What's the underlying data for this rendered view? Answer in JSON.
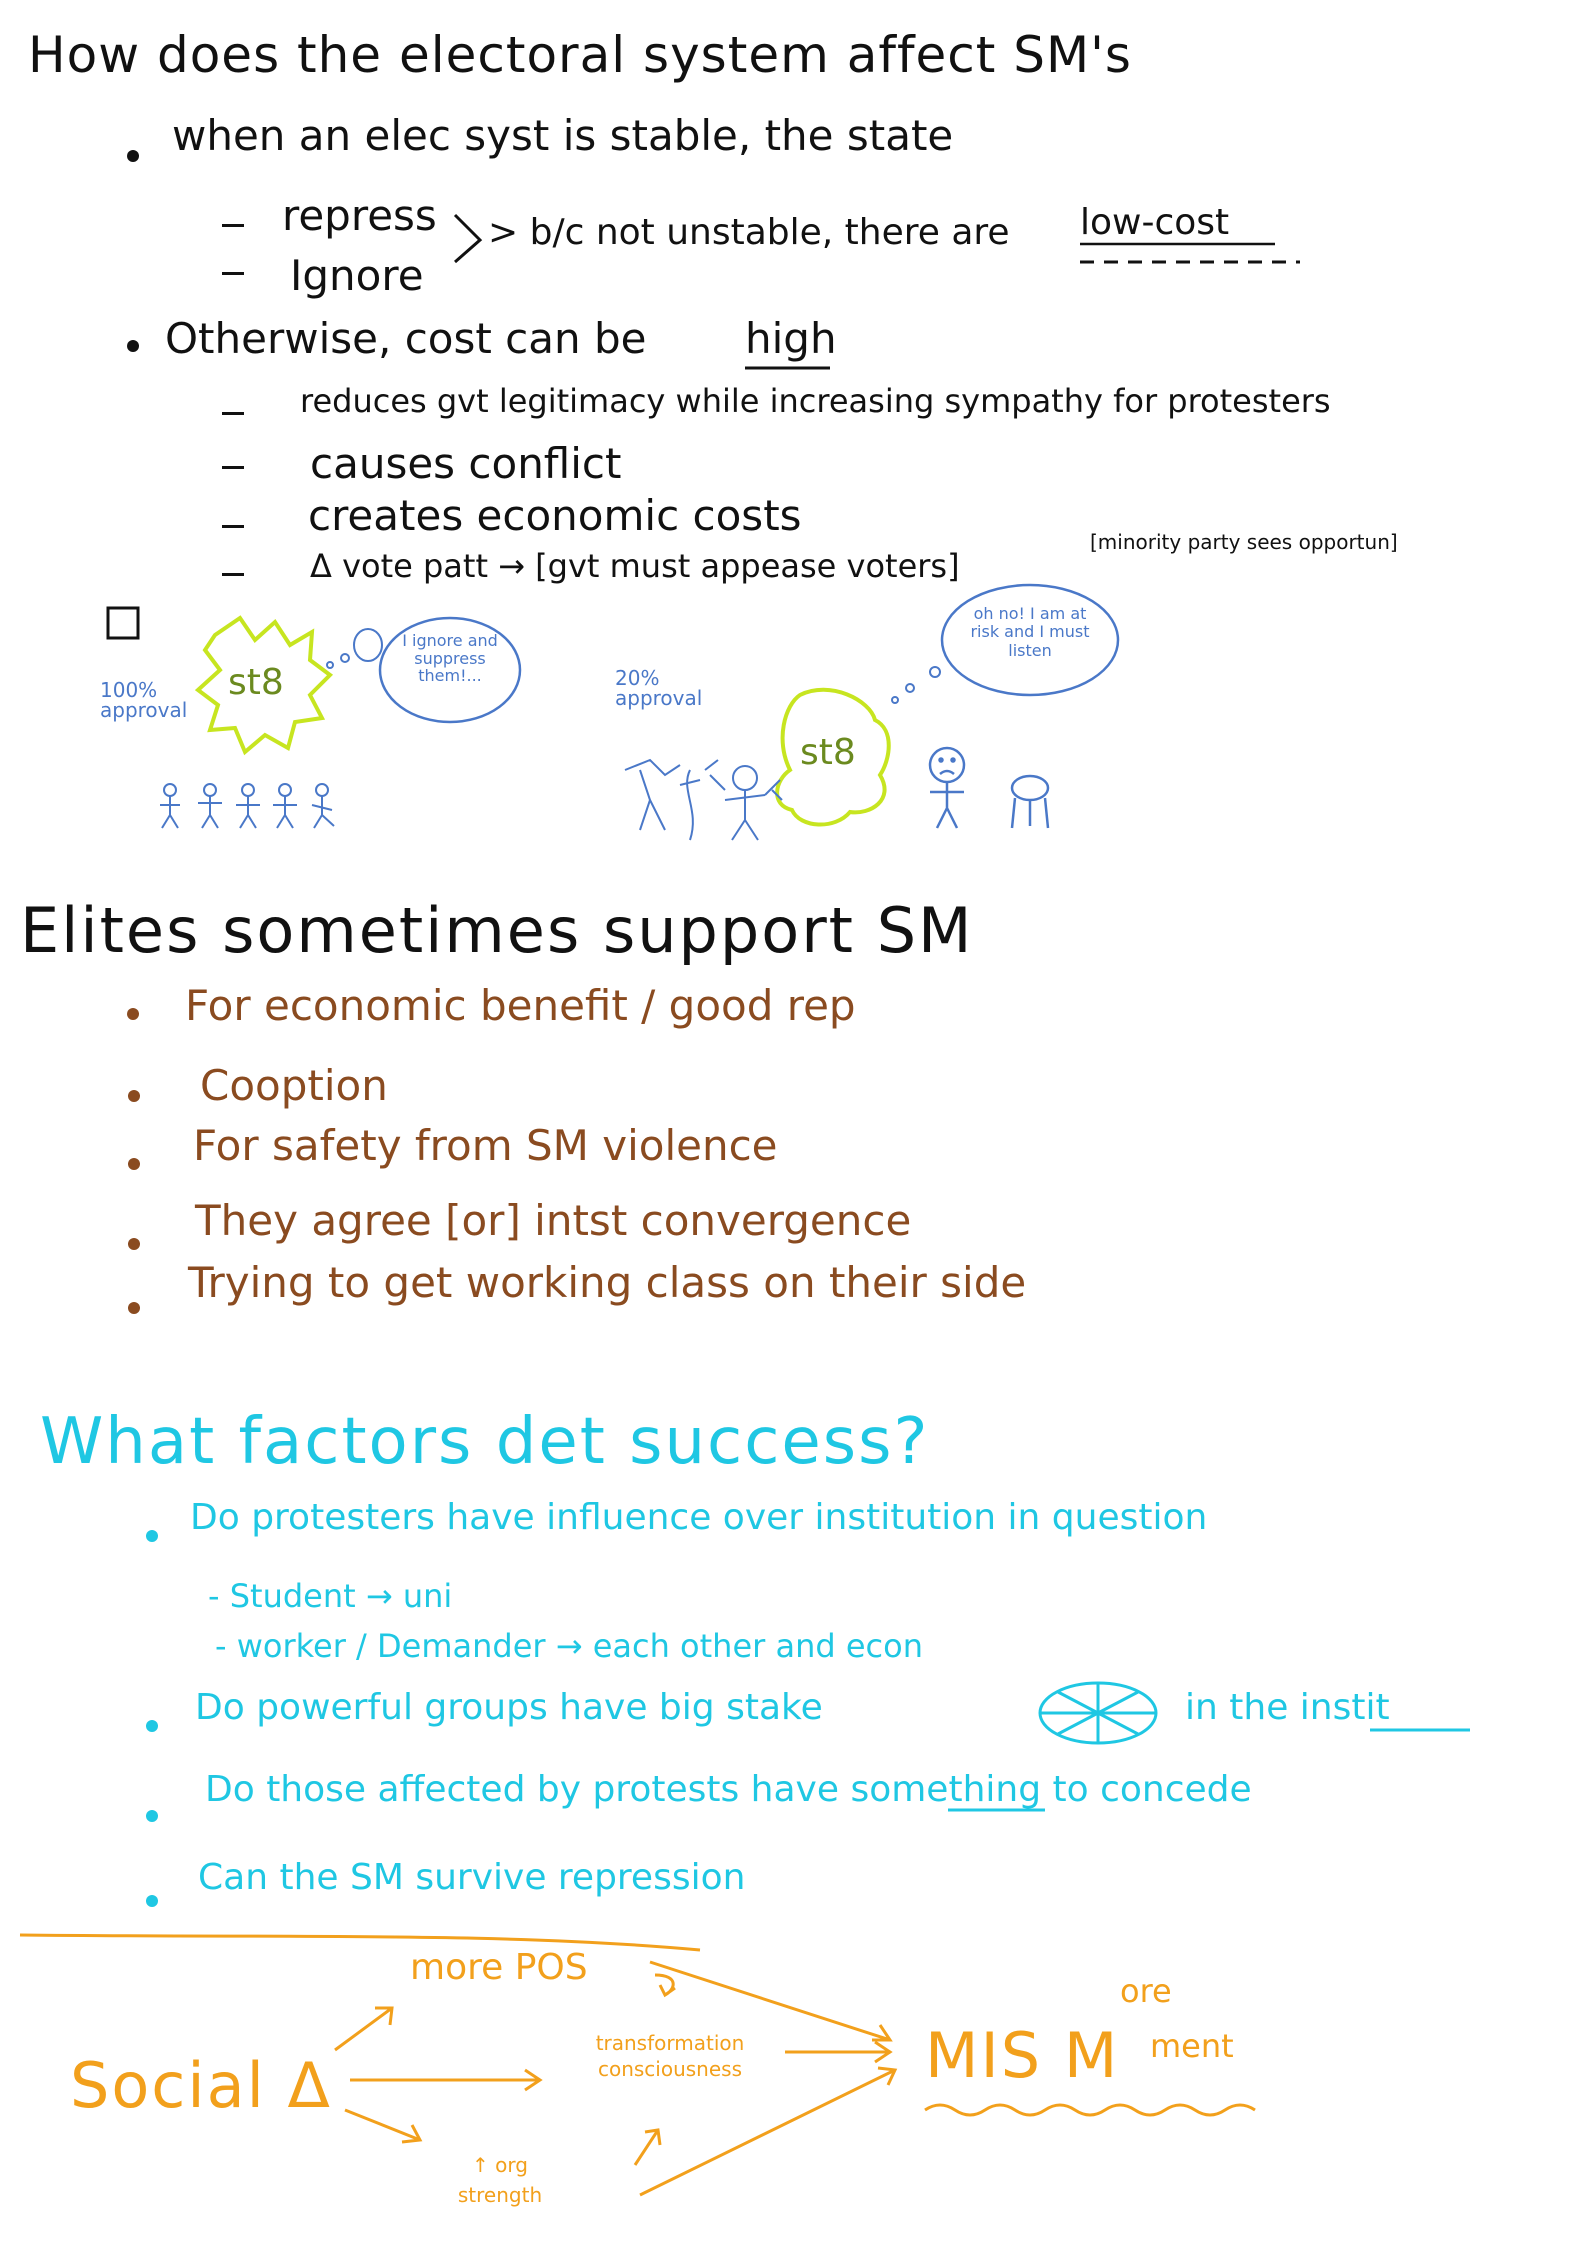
{
  "colors": {
    "ink": "#111111",
    "brown": "#8a4b20",
    "cyan": "#1fc7e3",
    "orange": "#f2a01c",
    "blue": "#4a78c8",
    "lime": "#c7e520"
  },
  "section1": {
    "heading": "How does the electoral system affect SM's",
    "b1": "when an elec syst is stable, the state",
    "sub1": "repress",
    "sub2": "Ignore",
    "brace_note": "> b/c not unstable, there are",
    "low_cost": "low-cost",
    "b2": "Otherwise, cost can be",
    "high": "high",
    "d1": "reduces gvt legitimacy while increasing sympathy for protesters",
    "d2": "causes conflict",
    "d3": "creates economic costs",
    "d4": "Δ vote patt → [gvt must appease voters]",
    "d4b": "[minority party sees opportun]"
  },
  "drawing1": {
    "approval_left": "100% approval",
    "st8": "st8",
    "bubble_left": "I ignore and suppress them!...",
    "approval_right": "20% approval",
    "bubble_right": "oh no! I am at risk and I must listen"
  },
  "section2": {
    "heading": "Elites sometimes support SM",
    "items": [
      "For economic benefit / good rep",
      "Cooption",
      "For safety from SM violence",
      "They agree [or] intst convergence",
      "Trying to get working class on their side"
    ]
  },
  "section3": {
    "heading": "What factors det success?",
    "i1": "Do protesters have influence over institution in question",
    "i1a": "- Student → uni",
    "i1b": "- worker / Demander → each other and econ",
    "i2a": "Do powerful groups have big stake",
    "i2b": "in the instit",
    "i3": "Do those affected by protests have something to concede",
    "i4": "Can the SM survive repression"
  },
  "diagram": {
    "social": "Social Δ",
    "more_pos": "more POS",
    "transformation": "transformation consciousness",
    "org_strength": "↑ org strength",
    "mis": "MIS M",
    "ore": "ore",
    "ment": "ment"
  }
}
